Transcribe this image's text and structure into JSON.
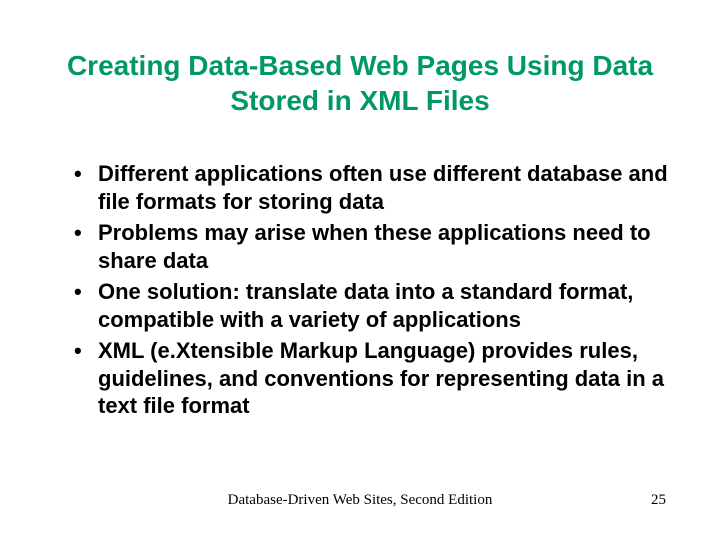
{
  "title": "Creating Data-Based Web Pages Using Data Stored in XML Files",
  "bullets": [
    "Different applications often use different database and file formats for storing data",
    "Problems may arise when these applications need to share data",
    "One solution: translate data into a standard format, compatible with a variety of applications",
    "XML (e.Xtensible Markup Language) provides rules, guidelines, and conventions for representing data in a text file format"
  ],
  "footer": {
    "center": "Database-Driven Web Sites, Second Edition",
    "page": "25"
  }
}
